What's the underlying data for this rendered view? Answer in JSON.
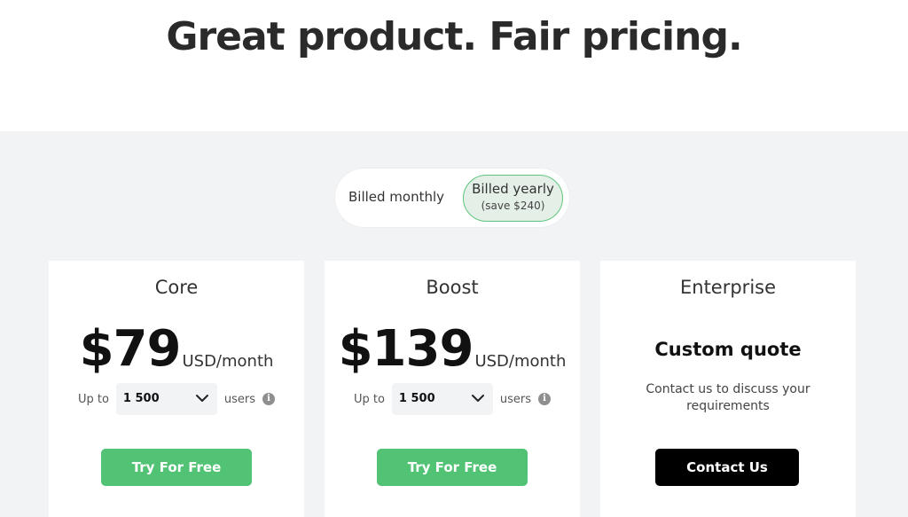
{
  "hero": {
    "title": "Great product. Fair pricing."
  },
  "billing_toggle": {
    "monthly_label": "Billed monthly",
    "yearly_label": "Billed yearly",
    "yearly_note": "(save $240)",
    "selected": "yearly"
  },
  "plans": [
    {
      "name": "Core",
      "price": "$79",
      "price_unit": "USD/month",
      "users_prefix": "Up to",
      "users_value": "1 500",
      "users_suffix": "users",
      "cta": "Try For Free"
    },
    {
      "name": "Boost",
      "price": "$139",
      "price_unit": "USD/month",
      "users_prefix": "Up to",
      "users_value": "1 500",
      "users_suffix": "users",
      "cta": "Try For Free"
    }
  ],
  "enterprise": {
    "name": "Enterprise",
    "headline": "Custom quote",
    "description": "Contact us to discuss your requirements",
    "cta": "Contact Us"
  },
  "colors": {
    "accent_green": "#52c374",
    "toggle_selected_bg": "#e4efe7",
    "section_bg": "#f2f3f5",
    "contact_button": "#000000"
  },
  "icons": {
    "select_chevron": "chevron-down-icon",
    "info": "info-icon"
  }
}
